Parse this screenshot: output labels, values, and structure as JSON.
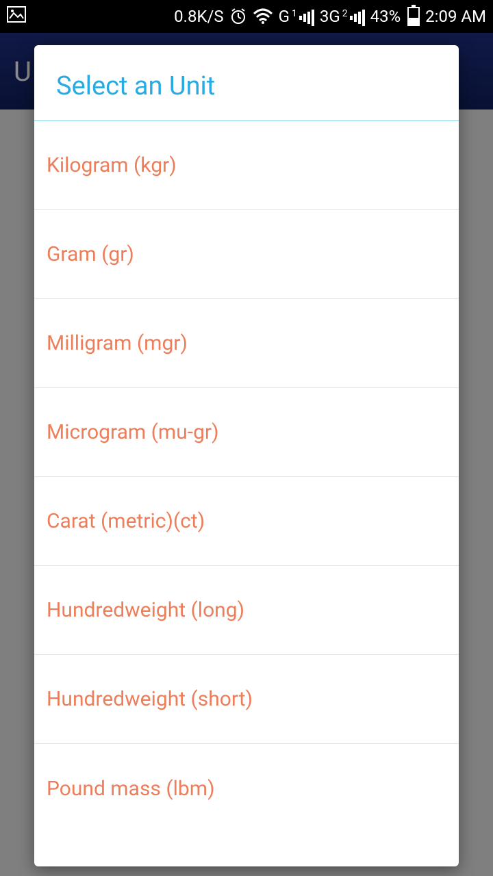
{
  "status": {
    "data_rate": "0.8K/S",
    "signal1_label": "G",
    "signal1_sup": "1",
    "signal2_label": "3G",
    "signal2_sup": "2",
    "battery_pct": "43%",
    "time": "2:09 AM"
  },
  "app_header": {
    "title": "U"
  },
  "dialog": {
    "title": "Select an Unit",
    "items": [
      "Kilogram (kgr)",
      "Gram (gr)",
      "Milligram (mgr)",
      "Microgram (mu-gr)",
      "Carat (metric)(ct)",
      "Hundredweight (long)",
      "Hundredweight (short)",
      "Pound mass (lbm)"
    ]
  }
}
